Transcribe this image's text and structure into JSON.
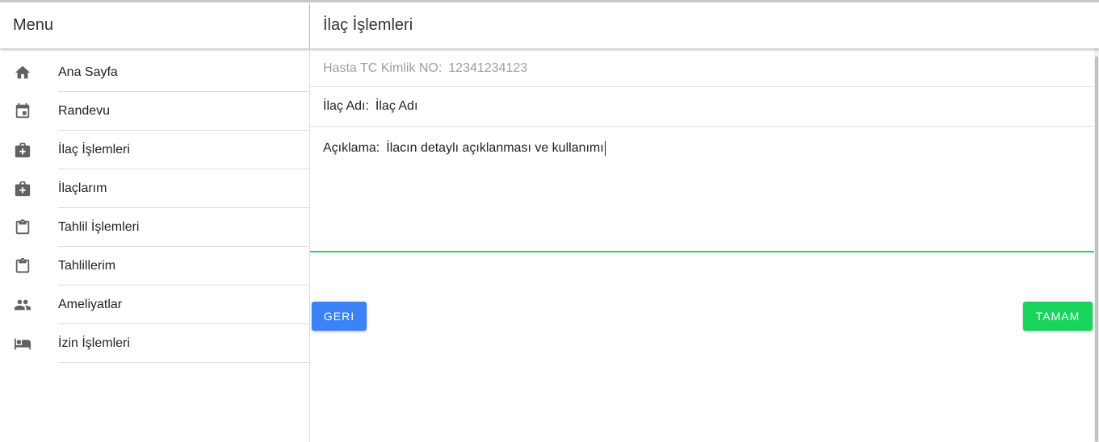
{
  "sidebar": {
    "title": "Menu",
    "items": [
      {
        "label": "Ana Sayfa",
        "icon": "home-icon"
      },
      {
        "label": "Randevu",
        "icon": "calendar-icon"
      },
      {
        "label": "İlaç İşlemleri",
        "icon": "medical-bag-icon"
      },
      {
        "label": "İlaçlarım",
        "icon": "medical-bag-icon"
      },
      {
        "label": "Tahlil İşlemleri",
        "icon": "clipboard-icon"
      },
      {
        "label": "Tahlillerim",
        "icon": "clipboard-icon"
      },
      {
        "label": "Ameliyatlar",
        "icon": "people-icon"
      },
      {
        "label": "İzin İşlemleri",
        "icon": "bed-icon"
      }
    ]
  },
  "main": {
    "title": "İlaç İşlemleri",
    "form": {
      "tc_label": "Hasta TC Kimlik NO:",
      "tc_value": "12341234123",
      "name_label": "İlaç Adı:",
      "name_value": "İlaç Adı",
      "desc_label": "Açıklama:",
      "desc_value": "İlacın detaylı açıklanması ve kullanımı"
    },
    "buttons": {
      "back": "GERI",
      "ok": "TAMAM"
    }
  },
  "colors": {
    "back_button": "#3b82f6",
    "ok_button": "#18d45c",
    "focus_underline": "#2ecc71"
  }
}
